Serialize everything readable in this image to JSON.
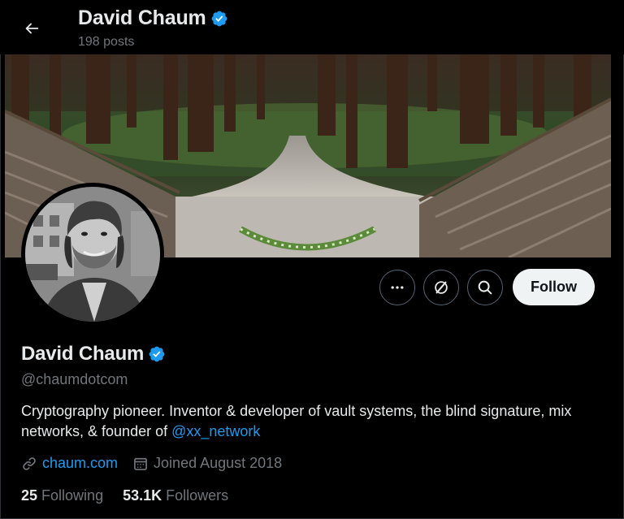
{
  "header": {
    "name": "David Chaum",
    "posts": "198 posts"
  },
  "profile": {
    "display_name": "David Chaum",
    "handle": "@chaumdotcom",
    "bio_text": "Cryptography pioneer. Inventor & developer of vault systems, the blind signature, mix networks, & founder of ",
    "bio_mention": "@xx_network",
    "website": "chaum.com",
    "joined": "Joined August 2018",
    "following_count": "25",
    "following_label": "Following",
    "followers_count": "53.1K",
    "followers_label": "Followers"
  },
  "actions": {
    "follow_label": "Follow",
    "more_icon": "more-horizontal-icon",
    "xmoney_icon": "x-money-icon",
    "search_icon": "search-icon"
  },
  "icons": {
    "back": "back-arrow-icon",
    "verified": "verified-badge-icon",
    "link": "link-icon",
    "calendar": "calendar-icon"
  },
  "colors": {
    "background": "#000000",
    "text_primary": "#e7e9ea",
    "text_secondary": "#71767b",
    "accent": "#1d9bf0",
    "follow_button_bg": "#eff3f4"
  }
}
